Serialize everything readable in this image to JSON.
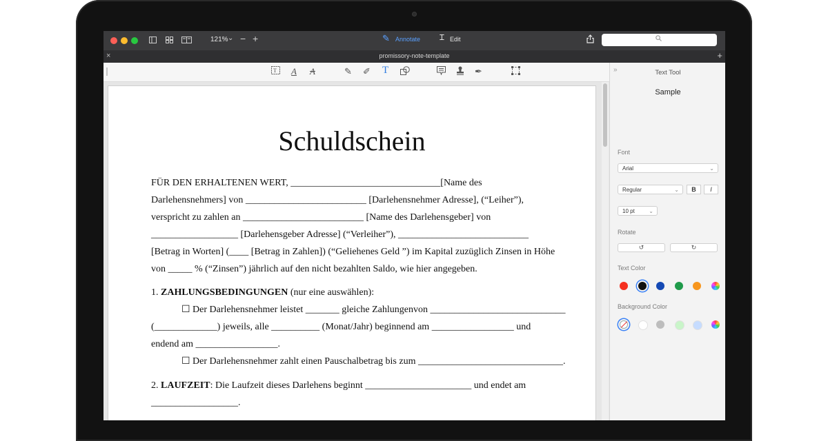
{
  "toolbar": {
    "zoom": "121%",
    "annotate_label": "Annotate",
    "edit_label": "Edit"
  },
  "tab": {
    "title": "promissory-note-template"
  },
  "document": {
    "title": "Schuldschein",
    "lines": [
      "FÜR DEN ERHALTENEN WERT, _______________________________[Name des",
      "Darlehensnehmers] von _________________________ [Darlehensnehmer Adresse], (“Leiher”),",
      "verspricht zu zahlen an _________________________ [Name des Darlehensgeber] von",
      "__________________ [Darlehensgeber Adresse] (“Verleiher”), ___________________________",
      "[Betrag in Worten] (____ [Betrag in Zahlen]) (“Geliehenes Geld ”) im Kapital zuzüglich Zinsen in Höhe",
      "von _____ % (“Zinsen”) jährlich auf den nicht bezahlten Saldo, wie hier angegeben."
    ],
    "section1": {
      "number": "1.",
      "heading": "ZAHLUNGSBEDINGUNGEN",
      "note": "(nur eine auswählen):",
      "option1_line1": "☐ Der Darlehensnehmer leistet _______ gleiche Zahlungenvon ____________________________",
      "option1_line2": "(_____________) jeweils, alle __________ (Monat/Jahr) beginnend am _________________ und",
      "option1_line3": "endend am _________________.",
      "option2": "☐  Der Darlehensnehmer zahlt einen Pauschalbetrag bis zum ______________________________."
    },
    "section2": {
      "number": "2.",
      "heading": "LAUFZEIT",
      "text": ": Die Laufzeit dieses Darlehens beginnt ______________________ und endet am",
      "text_line2": "__________________."
    }
  },
  "sidebar": {
    "title": "Text Tool",
    "sample": "Sample",
    "font_label": "Font",
    "font_value": "Arial",
    "style_value": "Regular",
    "bold_label": "B",
    "italic_label": "I",
    "size_value": "10 pt",
    "rotate_label": "Rotate",
    "text_color_label": "Text Color",
    "text_colors": [
      "#f5301f",
      "#111111",
      "#1449b4",
      "#1f9a4a",
      "#f7961e",
      "rainbow"
    ],
    "background_color_label": "Background Color",
    "background_colors": [
      "none",
      "#ffffff",
      "#bdbdbd",
      "#c9f5c9",
      "#c6dcff",
      "rainbow"
    ]
  }
}
